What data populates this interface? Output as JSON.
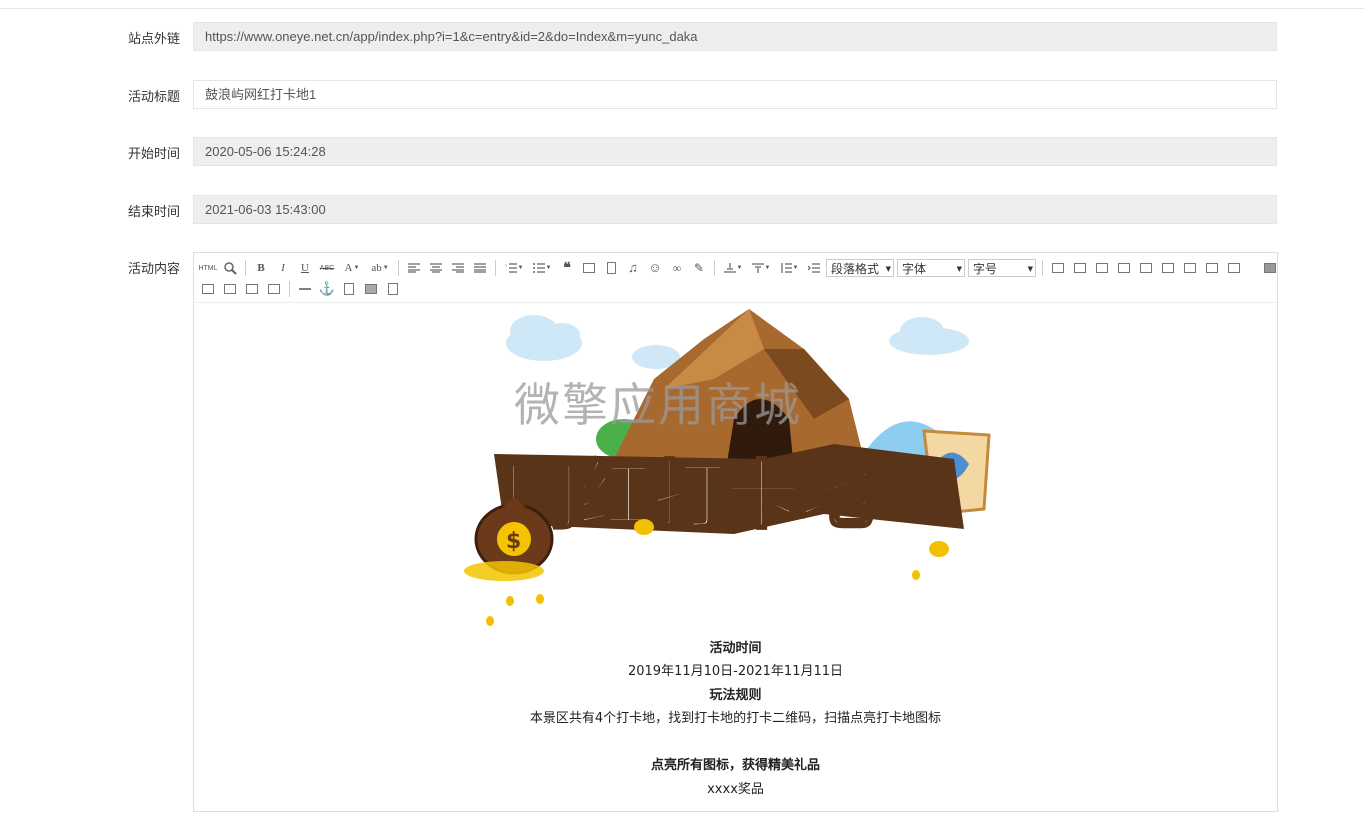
{
  "form": {
    "site_link": {
      "label": "站点外链",
      "value": "https://www.oneye.net.cn/app/index.php?i=1&c=entry&id=2&do=Index&m=yunc_daka"
    },
    "title": {
      "label": "活动标题",
      "value": "鼓浪屿网红打卡地1"
    },
    "start_time": {
      "label": "开始时间",
      "value": "2020-05-06 15:24:28"
    },
    "end_time": {
      "label": "结束时间",
      "value": "2021-06-03 15:43:00"
    },
    "content": {
      "label": "活动内容"
    }
  },
  "editor": {
    "toolbar": {
      "html_label": "HTML",
      "bold": "B",
      "italic": "I",
      "underline": "U",
      "strike": "ABC",
      "font_color": "A",
      "paragraph_select": "段落格式",
      "font_select": "字体",
      "size_select": "字号"
    },
    "banner": {
      "title_text": "网红打卡地",
      "watermark": "微擎应用商城"
    },
    "body": [
      {
        "text": "活动时间",
        "bold": true
      },
      {
        "text": "2019年11月10日-2021年11月11日",
        "bold": false
      },
      {
        "text": "玩法规则",
        "bold": true
      },
      {
        "text": "本景区共有4个打卡地，找到打卡地的打卡二维码，扫描点亮打卡地图标",
        "bold": false
      },
      {
        "text": "点亮所有图标，获得精美礼品",
        "bold": true
      },
      {
        "text": "xxxx奖品",
        "bold": false
      }
    ]
  },
  "colors": {
    "readonly_bg": "#eeeeee",
    "border": "#e5e5e5",
    "title_yellow": "#f2c200",
    "mountain_brown": "#8b5a2b",
    "banner_dark": "#5a3418",
    "cloud": "#cfe8f7"
  }
}
